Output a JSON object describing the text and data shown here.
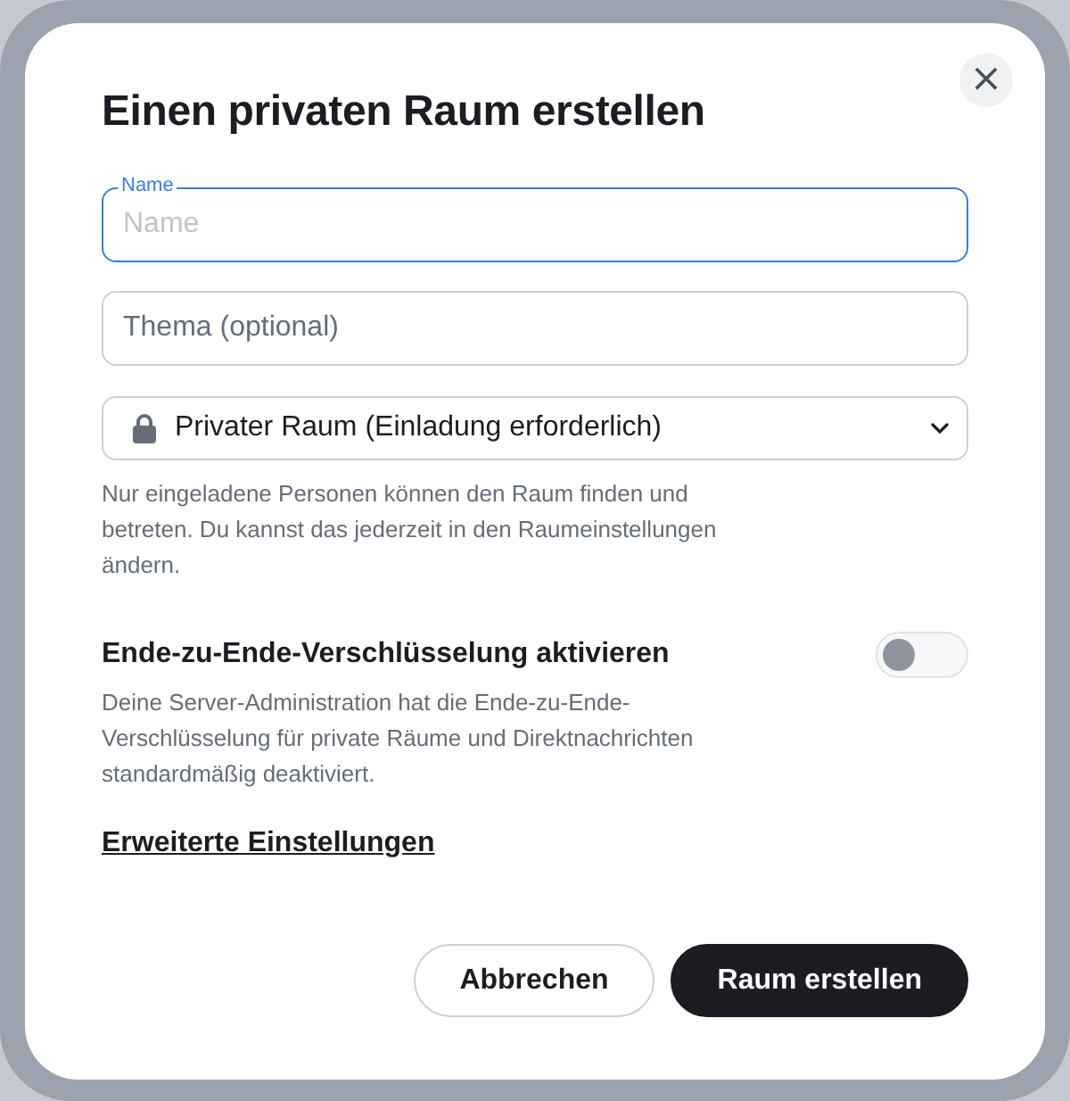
{
  "dialog": {
    "title": "Einen privaten Raum erstellen",
    "close": "×"
  },
  "fields": [
    {
      "kind": "text",
      "label": "Name",
      "placeholder": "Name",
      "focused": true
    },
    {
      "kind": "text",
      "placeholder": "Thema (optional)",
      "focused": false
    },
    {
      "kind": "select",
      "value": "Privater Raum (Einladung erforderlich)",
      "focused": false
    }
  ],
  "visibility_help": "Nur eingeladene Personen können den Raum finden und betreten. Du kannst das jederzeit in den Raumeinstellungen ändern.",
  "encryption": {
    "label": "Ende-zu-Ende-Verschlüsselung aktivieren",
    "on": false,
    "description": "Deine Server-Administration hat die Ende-zu-Ende-Verschlüsselung für private Räume und Direktnachrichten standardmäßig deaktiviert."
  },
  "advanced_link": "Erweiterte Einstellungen",
  "buttons": [
    {
      "label": "Abbrechen",
      "kind": "secondary"
    },
    {
      "label": "Raum erstellen",
      "kind": "primary"
    }
  ]
}
